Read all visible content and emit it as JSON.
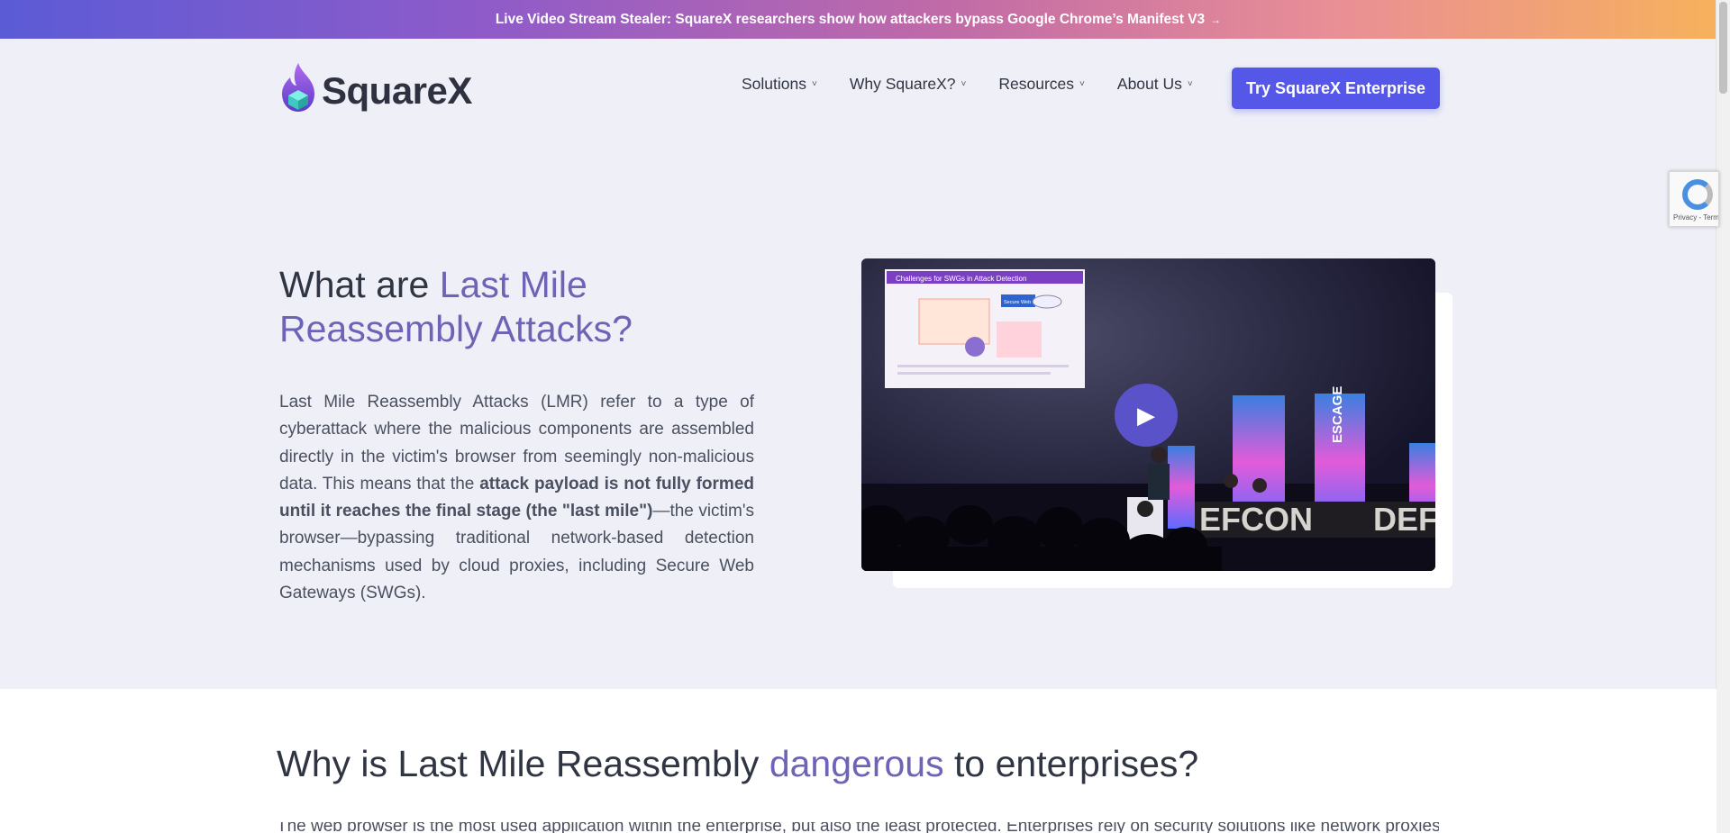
{
  "banner": {
    "text": "Live Video Stream Stealer: SquareX researchers show how attackers bypass Google Chrome’s Manifest V3",
    "arrow": "→"
  },
  "header": {
    "logo_text": "SquareX",
    "nav": [
      {
        "label": "Solutions",
        "chevron": "˅"
      },
      {
        "label": "Why SquareX?",
        "chevron": "˅"
      },
      {
        "label": "Resources",
        "chevron": "˅"
      },
      {
        "label": "About Us",
        "chevron": "˅"
      }
    ],
    "cta_label": "Try SquareX Enterprise"
  },
  "recaptcha": {
    "text": "Privacy - Terms"
  },
  "hero": {
    "title_plain": "What are ",
    "title_accent": "Last Mile Reassembly Attacks?",
    "paragraph_part1": "Last Mile Reassembly Attacks (LMR) refer to a type of cyberattack where the malicious components are assembled directly in the victim's browser from seemingly non-malicious data. This means that the ",
    "paragraph_bold": "attack payload is not fully formed until it reaches the final stage (the \"last mile\")",
    "paragraph_part2": "—the victim's browser—bypassing traditional network-based detection mechanisms used by cloud proxies, including Secure Web Gateways (SWGs).",
    "video": {
      "slide_title": "Challenges for SWGs in Attack Detection",
      "slide_box": "Secure Web Gateway",
      "stage_left": "EFCON",
      "stage_right": "DEF",
      "banner_text": "ESCAGE",
      "play_icon": "▶"
    }
  },
  "section2": {
    "title_part1": "Why is Last Mile Reassembly ",
    "title_accent": "dangerous",
    "title_part2": " to enterprises?",
    "cut_text": "The web browser is the most used application within the enterprise, but also the least protected. Enterprises rely on security solutions like network proxies"
  },
  "colors": {
    "accent": "#6d64b7",
    "cta": "#5457e7",
    "background": "#eff0f7"
  }
}
